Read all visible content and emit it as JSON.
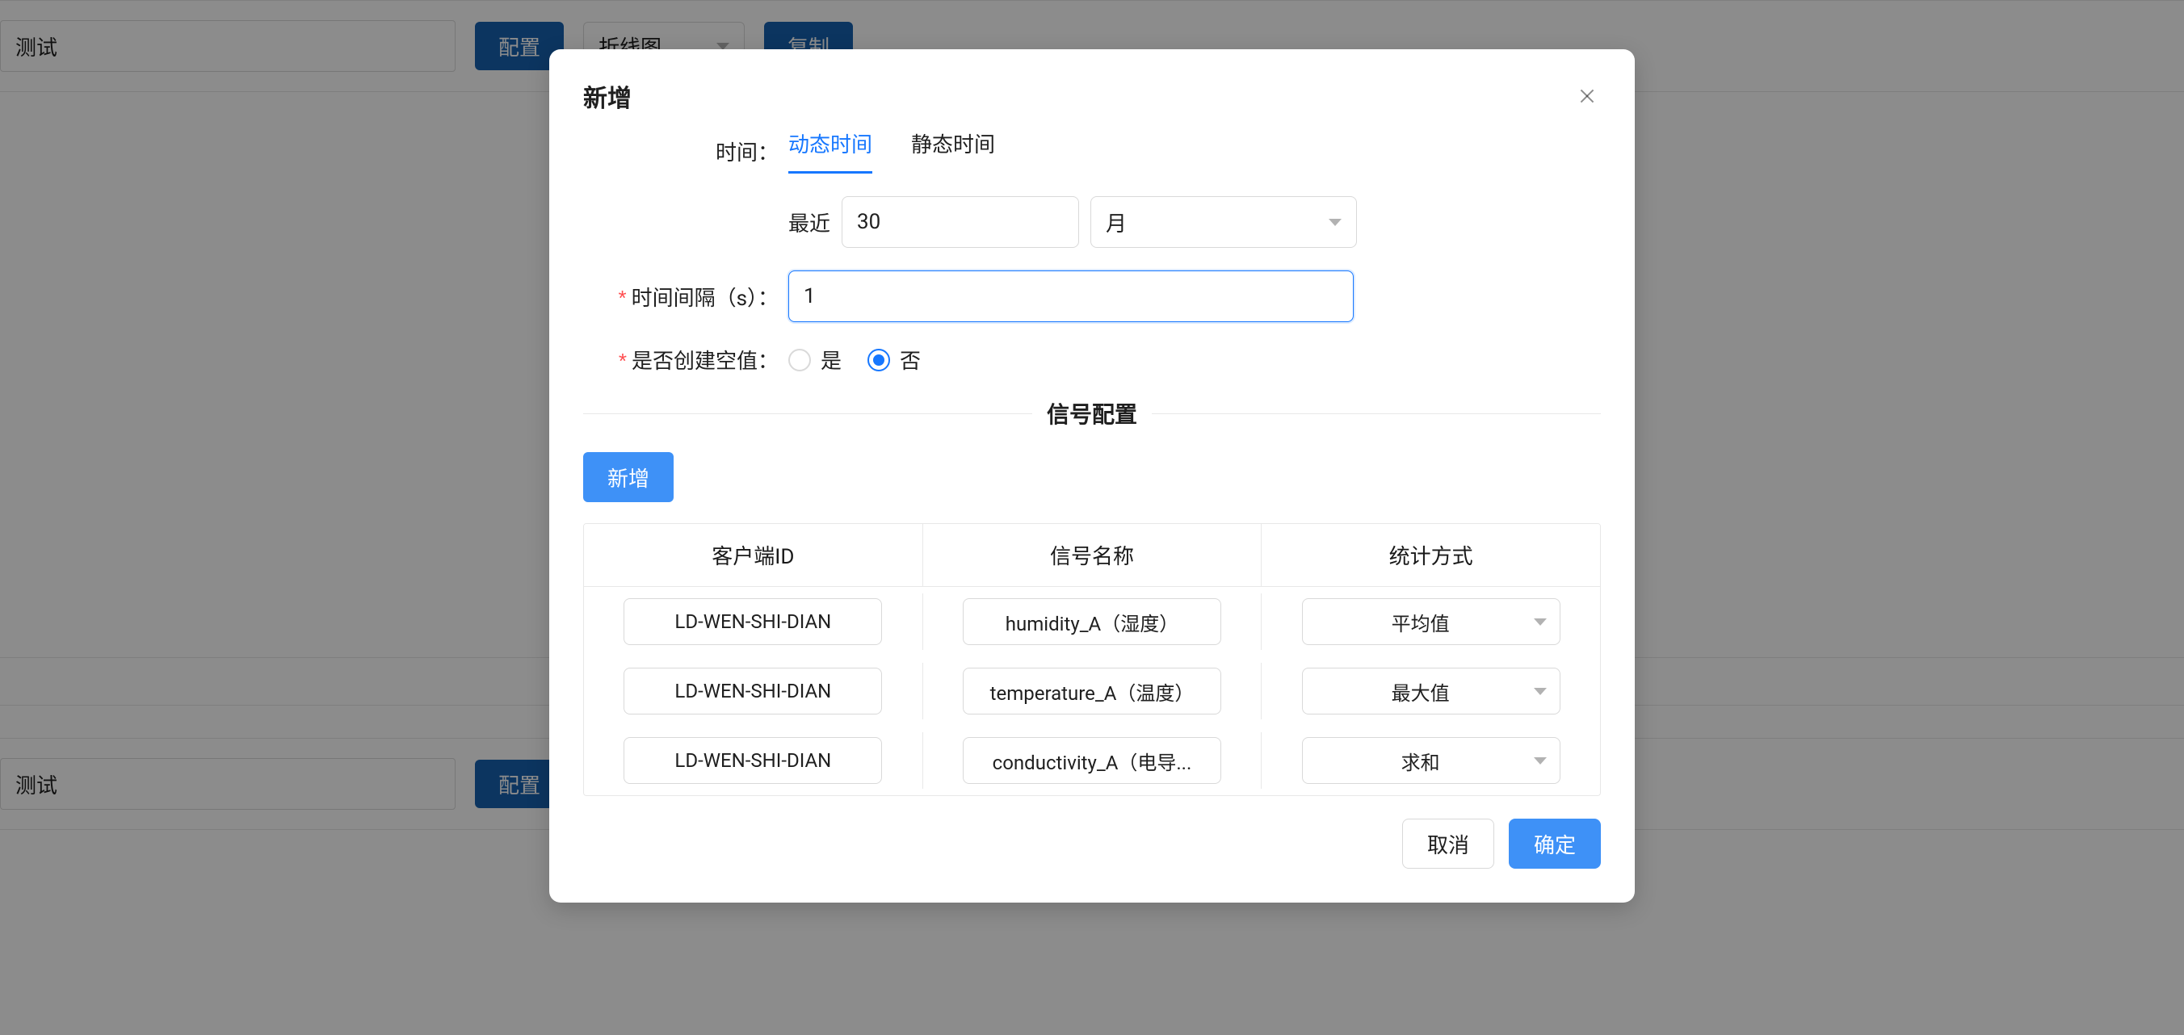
{
  "background": {
    "card1": {
      "input_value": "测试",
      "config_btn": "配置",
      "chart_select": "折线图",
      "copy_btn": "复制"
    },
    "card2": {
      "input_value": "测试",
      "config_btn": "配置"
    }
  },
  "modal": {
    "title": "新增",
    "time_label": "时间：",
    "tabs": {
      "dynamic": "动态时间",
      "static": "静态时间"
    },
    "recent": {
      "label": "最近",
      "value": "30",
      "unit": "月"
    },
    "interval": {
      "label": "时间间隔（s）：",
      "value": "1"
    },
    "create_empty": {
      "label": "是否创建空值：",
      "yes": "是",
      "no": "否"
    },
    "signal_section_title": "信号配置",
    "add_signal_btn": "新增",
    "table": {
      "headers": {
        "client_id": "客户端ID",
        "signal_name": "信号名称",
        "stat_method": "统计方式"
      },
      "rows": [
        {
          "client_id": "LD-WEN-SHI-DIAN",
          "signal_name": "humidity_A（湿度）",
          "stat_method": "平均值"
        },
        {
          "client_id": "LD-WEN-SHI-DIAN",
          "signal_name": "temperature_A（温度）",
          "stat_method": "最大值"
        },
        {
          "client_id": "LD-WEN-SHI-DIAN",
          "signal_name": "conductivity_A（电导...",
          "stat_method": "求和"
        }
      ]
    },
    "footer": {
      "cancel": "取消",
      "ok": "确定"
    }
  }
}
